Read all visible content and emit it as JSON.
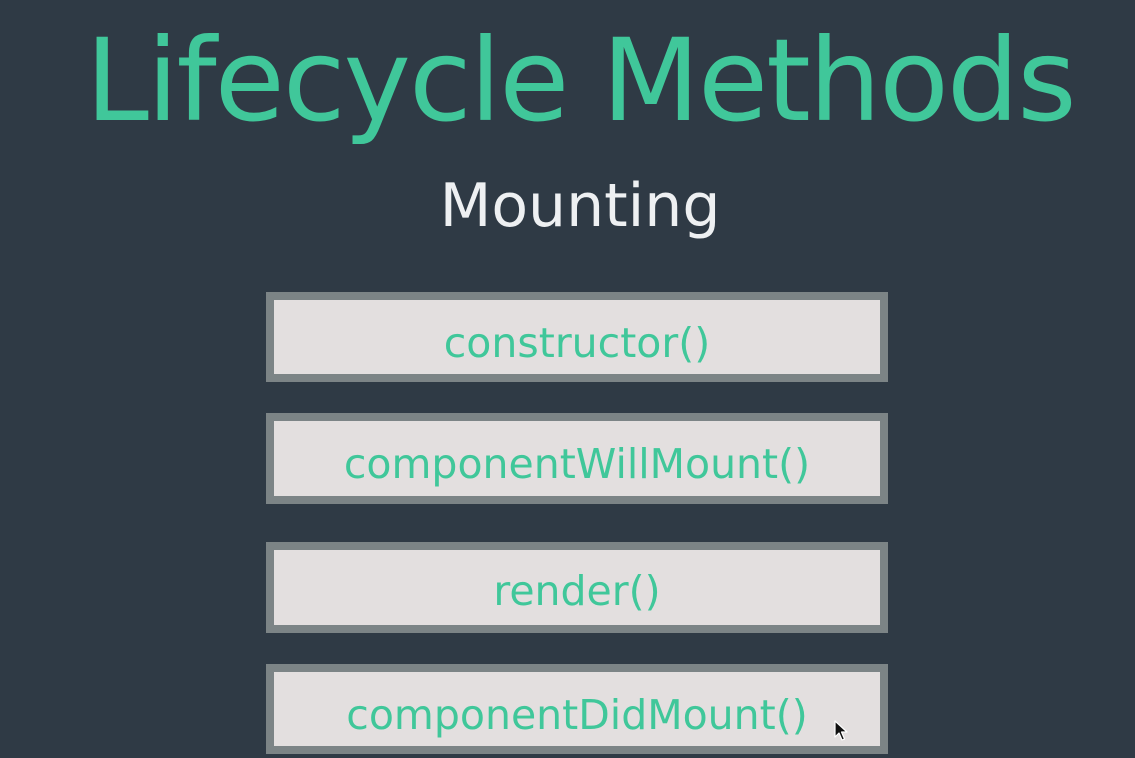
{
  "slide": {
    "title": "Lifecycle Methods",
    "subtitle": "Mounting",
    "methods": [
      "constructor()",
      "componentWillMount()",
      "render()",
      "componentDidMount()"
    ]
  },
  "colors": {
    "background": "#2f3a45",
    "accent": "#40c79a",
    "box_fill": "#e3dfdf",
    "box_border": "#7c8486",
    "subtitle": "#eef0f2"
  },
  "icons": {
    "cursor": "mouse-pointer-icon"
  }
}
